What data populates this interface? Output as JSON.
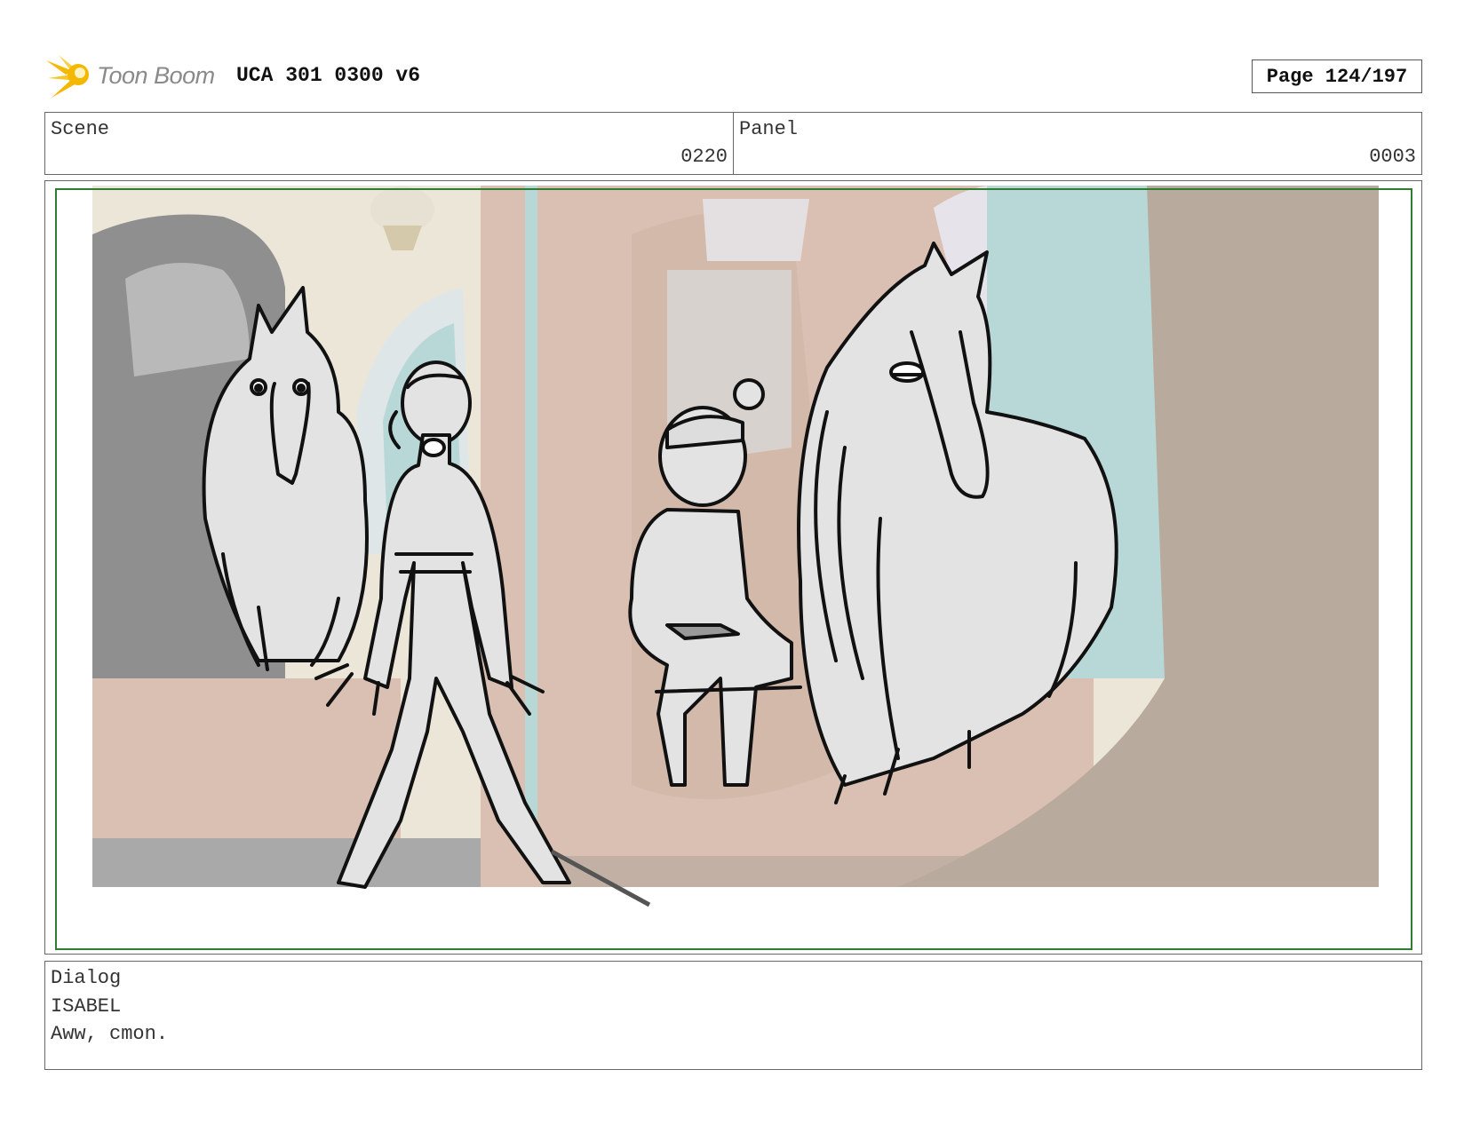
{
  "header": {
    "logo_text": "Toon Boom",
    "title": "UCA 301 0300 v6",
    "page": "Page 124/197"
  },
  "info": {
    "scene_label": "Scene",
    "scene_value": "0220",
    "panel_label": "Panel",
    "panel_value": "0003"
  },
  "dialog": {
    "label": "Dialog",
    "character": "ISABEL",
    "line": "Aww, cmon."
  },
  "colors": {
    "safe_frame": "#2f7d32",
    "logo_flare": "#f5b800",
    "wall_pink": "#d9c0b2",
    "wall_taupe": "#b9aa9e",
    "window_teal": "#b8d8d8",
    "sketch_fill": "#e3e3e3"
  }
}
